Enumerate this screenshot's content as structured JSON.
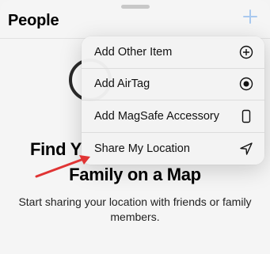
{
  "header": {
    "title": "People"
  },
  "empty_state": {
    "headline_line1": "Find Y",
    "headline_line2": "Family on a Map",
    "subtitle": "Start sharing your location with friends or family members."
  },
  "menu": {
    "items": [
      {
        "label": "Add Other Item",
        "icon": "plus-circle-icon"
      },
      {
        "label": "Add AirTag",
        "icon": "airtag-icon"
      },
      {
        "label": "Add MagSafe Accessory",
        "icon": "phone-icon"
      },
      {
        "label": "Share My Location",
        "icon": "location-arrow-icon"
      }
    ]
  },
  "colors": {
    "accent": "#1a8cff",
    "annotation_arrow": "#e03434"
  }
}
